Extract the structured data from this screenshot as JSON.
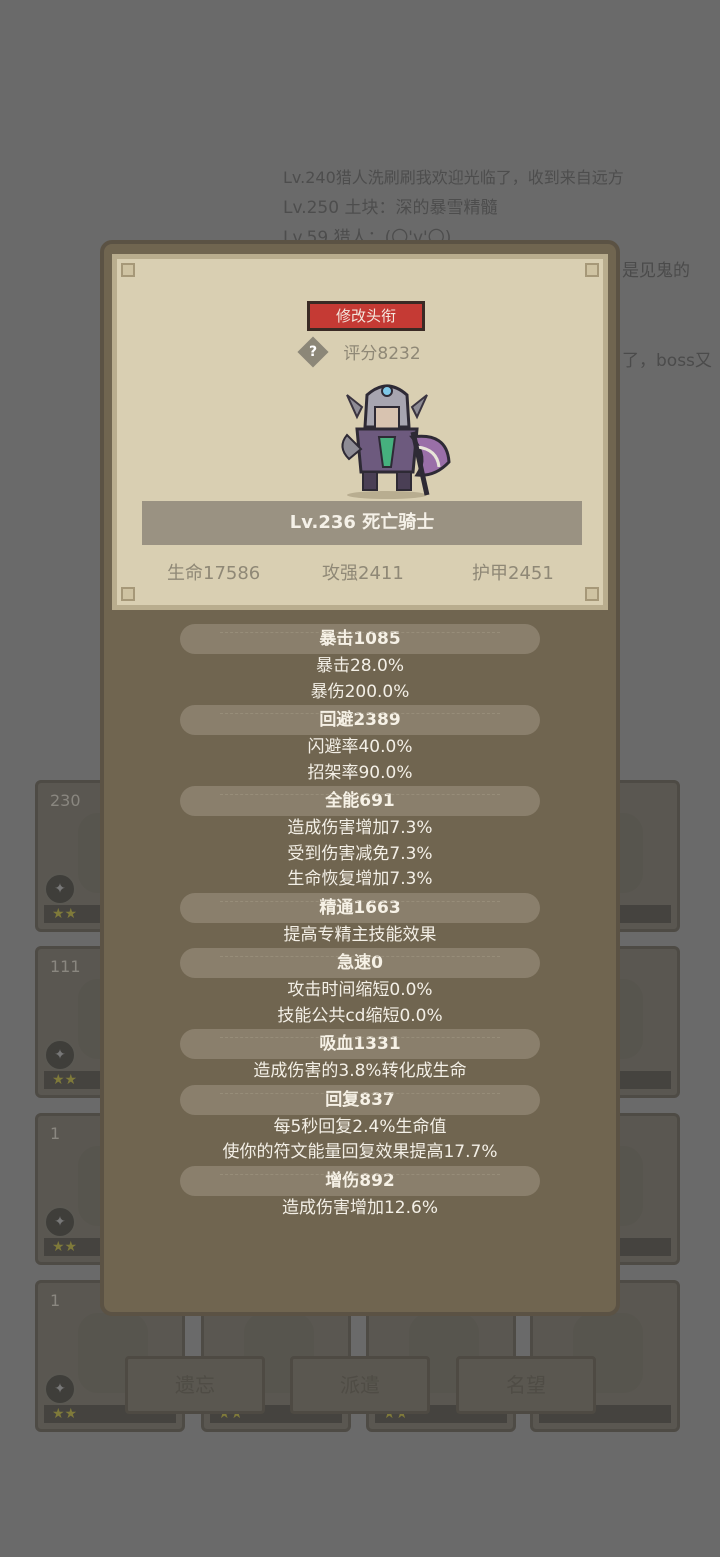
{
  "background_log": {
    "lines": [
      "Lv.240猎人洗刷刷我欢迎光临了，收到来自远方",
      "Lv.250 土块：深的暴雪精髓",
      "Lv.59 猎人：(〇'v'〇)"
    ],
    "side_text_1": "是见鬼的",
    "side_text_2": "了，boss又"
  },
  "background_cards": {
    "rows": [
      {
        "left": "230",
        "right": ""
      },
      {
        "left": "111",
        "right": ""
      },
      {
        "left": "1",
        "right": ""
      },
      {
        "left": "1",
        "right": ""
      }
    ],
    "stars_text": "★★"
  },
  "background_tabs": [
    "遗忘",
    "派遣",
    "名望"
  ],
  "panel": {
    "edit_title_button": "修改头衔",
    "score": "评分8232",
    "score_icon": "?",
    "hero_name": "Lv.236 死亡骑士",
    "base_stats": {
      "hp": "生命17586",
      "attack": "攻强2411",
      "armor": "护甲2451"
    },
    "sections": [
      {
        "title": "暴击1085",
        "lines": [
          "暴击28.0%",
          "暴伤200.0%"
        ]
      },
      {
        "title": "回避2389",
        "lines": [
          "闪避率40.0%",
          "招架率90.0%"
        ]
      },
      {
        "title": "全能691",
        "lines": [
          "造成伤害增加7.3%",
          "受到伤害减免7.3%",
          "生命恢复增加7.3%"
        ]
      },
      {
        "title": "精通1663",
        "lines": [
          "提高专精主技能效果"
        ]
      },
      {
        "title": "急速0",
        "lines": [
          "攻击时间缩短0.0%",
          "技能公共cd缩短0.0%"
        ]
      },
      {
        "title": "吸血1331",
        "lines": [
          "造成伤害的3.8%转化成生命"
        ]
      },
      {
        "title": "回复837",
        "lines": [
          "每5秒回复2.4%生命值",
          "使你的符文能量回复效果提高17.7%"
        ]
      },
      {
        "title": "增伤892",
        "lines": [
          "造成伤害增加12.6%"
        ]
      }
    ]
  },
  "colors": {
    "dim_background": "#6a6a6a",
    "panel": "#706550",
    "parchment": "#d9cfb2",
    "edit_button": "#c53a34"
  }
}
